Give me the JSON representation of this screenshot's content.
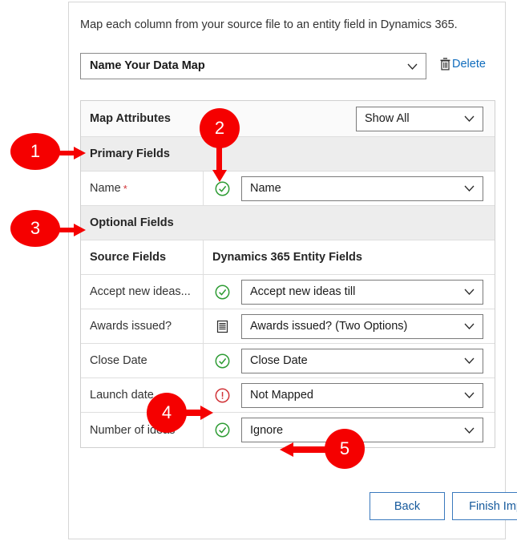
{
  "dialog": {
    "intro": "Map each column from your source file to an entity field in Dynamics 365.",
    "map_name_value": "Name Your Data Map",
    "delete_label": "Delete",
    "delete_icon": "trash-icon",
    "chevron_icon": "chevron-down-icon"
  },
  "table": {
    "map_attributes_label": "Map Attributes",
    "show_filter_value": "Show All",
    "primary_section_label": "Primary Fields",
    "optional_section_label": "Optional Fields",
    "col_source_header": "Source Fields",
    "col_entity_header": "Dynamics 365 Entity Fields",
    "primary_rows": [
      {
        "source": "Name",
        "required": true,
        "required_marker": "*",
        "status_icon": "check-circle-icon",
        "status": "mapped",
        "entity_value": "Name"
      }
    ],
    "optional_rows": [
      {
        "source": "Accept new ideas...",
        "required": false,
        "status_icon": "check-circle-icon",
        "status": "mapped",
        "entity_value": "Accept new ideas till"
      },
      {
        "source": "Awards issued?",
        "required": false,
        "status_icon": "list-document-icon",
        "status": "option-set",
        "entity_value": "Awards issued? (Two Options)"
      },
      {
        "source": "Close Date",
        "required": false,
        "status_icon": "check-circle-icon",
        "status": "mapped",
        "entity_value": "Close Date"
      },
      {
        "source": "Launch date",
        "required": false,
        "status_icon": "error-circle-icon",
        "status": "not-mapped",
        "entity_value": "Not Mapped"
      },
      {
        "source": "Number of ideas",
        "required": false,
        "status_icon": "check-circle-icon",
        "status": "ignored",
        "entity_value": "Ignore"
      }
    ]
  },
  "footer": {
    "back_label": "Back",
    "finish_label": "Finish Import"
  },
  "annotations": {
    "accent_color": "#f50000",
    "items": [
      {
        "number": "1",
        "target": "primary-fields-section"
      },
      {
        "number": "2",
        "target": "name-row-status-icon"
      },
      {
        "number": "3",
        "target": "optional-fields-section"
      },
      {
        "number": "4",
        "target": "launch-date-status-icon"
      },
      {
        "number": "5",
        "target": "number-of-ideas-entity-select"
      }
    ]
  },
  "colors": {
    "link": "#0f6cbd",
    "required": "#d13438",
    "ok": "#2e9c34",
    "error": "#d13438",
    "section_bg": "#ededed",
    "button_border": "#3a79bd"
  }
}
